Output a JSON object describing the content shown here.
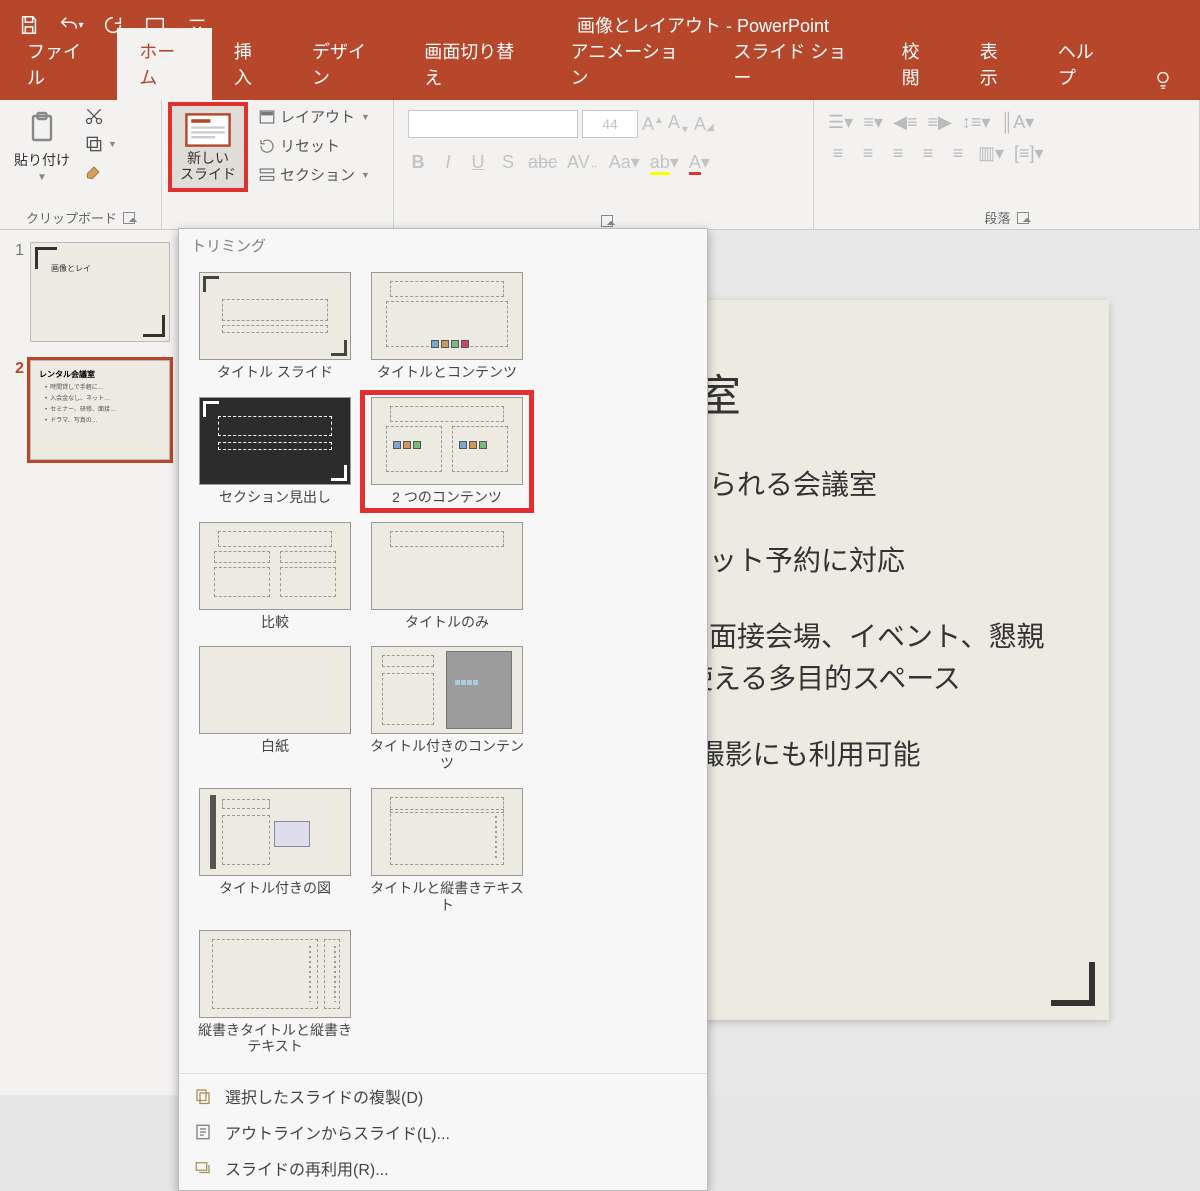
{
  "app_title": "画像とレイアウト - PowerPoint",
  "tabs": {
    "file": "ファイル",
    "home": "ホーム",
    "insert": "挿入",
    "design": "デザイン",
    "transition": "画面切り替え",
    "animation": "アニメーション",
    "slideshow": "スライド ショー",
    "review": "校閲",
    "view": "表示",
    "help": "ヘルプ"
  },
  "ribbon": {
    "clipboard": {
      "paste": "貼り付け",
      "group": "クリップボード"
    },
    "slides": {
      "new_slide": "新しい\nスライド",
      "layout": "レイアウト",
      "reset": "リセット",
      "section": "セクション"
    },
    "font": {
      "size": "44",
      "group": "",
      "launcher": true
    },
    "paragraph": {
      "group": "段落"
    }
  },
  "gallery": {
    "theme": "トリミング",
    "items": [
      "タイトル スライド",
      "タイトルとコンテンツ",
      "セクション見出し",
      "2 つのコンテンツ",
      "比較",
      "タイトルのみ",
      "白紙",
      "タイトル付きのコンテンツ",
      "タイトル付きの図",
      "タイトルと縦書きテキスト",
      "縦書きタイトルと縦書きテキスト"
    ],
    "footer": {
      "duplicate": "選択したスライドの複製(D)",
      "outline": "アウトラインからスライド(L)...",
      "reuse": "スライドの再利用(R)..."
    }
  },
  "thumbs": {
    "slide1_title": "画像とレイ",
    "slide2_title": "レンタル会議室",
    "slide2_bullets": [
      "時間貸しで手軽に…",
      "入会金なし、ネット…",
      "セミナー、研修、面接…",
      "ドラマ、写真の…"
    ]
  },
  "slide": {
    "title": "会議室",
    "bullets": [
      "借りられる会議室",
      "、ネット予約に対応",
      "験・面接会場、イベント、懇親",
      "途に使える多目的スペース",
      "?の撮影にも利用可能"
    ],
    "b3b": "途に使える多目的スペース"
  }
}
